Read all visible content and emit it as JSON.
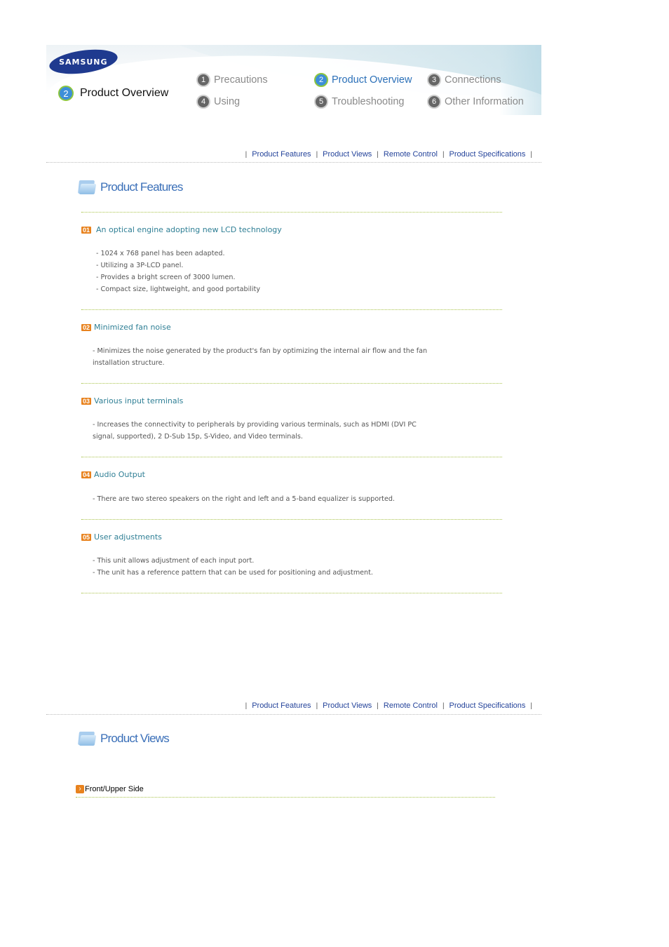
{
  "header": {
    "logo_text": "SAMSUNG",
    "current_section": {
      "number": "2",
      "label": "Product Overview"
    },
    "nav": [
      {
        "number": "1",
        "label": "Precautions",
        "active": false
      },
      {
        "number": "2",
        "label": "Product Overview",
        "active": true
      },
      {
        "number": "3",
        "label": "Connections",
        "active": false
      },
      {
        "number": "4",
        "label": "Using",
        "active": false
      },
      {
        "number": "5",
        "label": "Troubleshooting",
        "active": false
      },
      {
        "number": "6",
        "label": "Other Information",
        "active": false
      }
    ]
  },
  "subnav": {
    "separator": "|",
    "links": [
      "Product Features",
      "Product Views",
      "Remote Control",
      "Product Specifications"
    ]
  },
  "features_section": {
    "title": "Product Features",
    "items": [
      {
        "badge": "01",
        "title": "An optical engine adopting new LCD technology",
        "lines": [
          "- 1024 x 768 panel has been adapted.",
          "- Utilizing a 3P-LCD panel.",
          "- Provides a bright screen of 3000 lumen.",
          "- Compact size, lightweight, and good portability"
        ]
      },
      {
        "badge": "02",
        "title": "Minimized fan noise",
        "lines": [
          "- Minimizes the noise generated by the product's fan by optimizing the internal air flow and the fan",
          "installation structure."
        ]
      },
      {
        "badge": "03",
        "title": "Various input terminals",
        "lines": [
          "- Increases the connectivity to peripherals by providing various terminals, such as HDMI (DVI PC",
          "signal, supported), 2 D-Sub 15p, S-Video, and Video terminals."
        ]
      },
      {
        "badge": "04",
        "title": "Audio Output",
        "lines": [
          "- There are two stereo speakers on the right and left and a 5-band equalizer is supported."
        ]
      },
      {
        "badge": "05",
        "title": "User adjustments",
        "lines": [
          "- This unit allows adjustment of each input port.",
          "- The unit has a reference pattern that can be used for positioning and adjustment."
        ]
      }
    ]
  },
  "views_section": {
    "title": "Product Views",
    "subheading": "Front/Upper Side",
    "arrow_glyph": "›"
  }
}
